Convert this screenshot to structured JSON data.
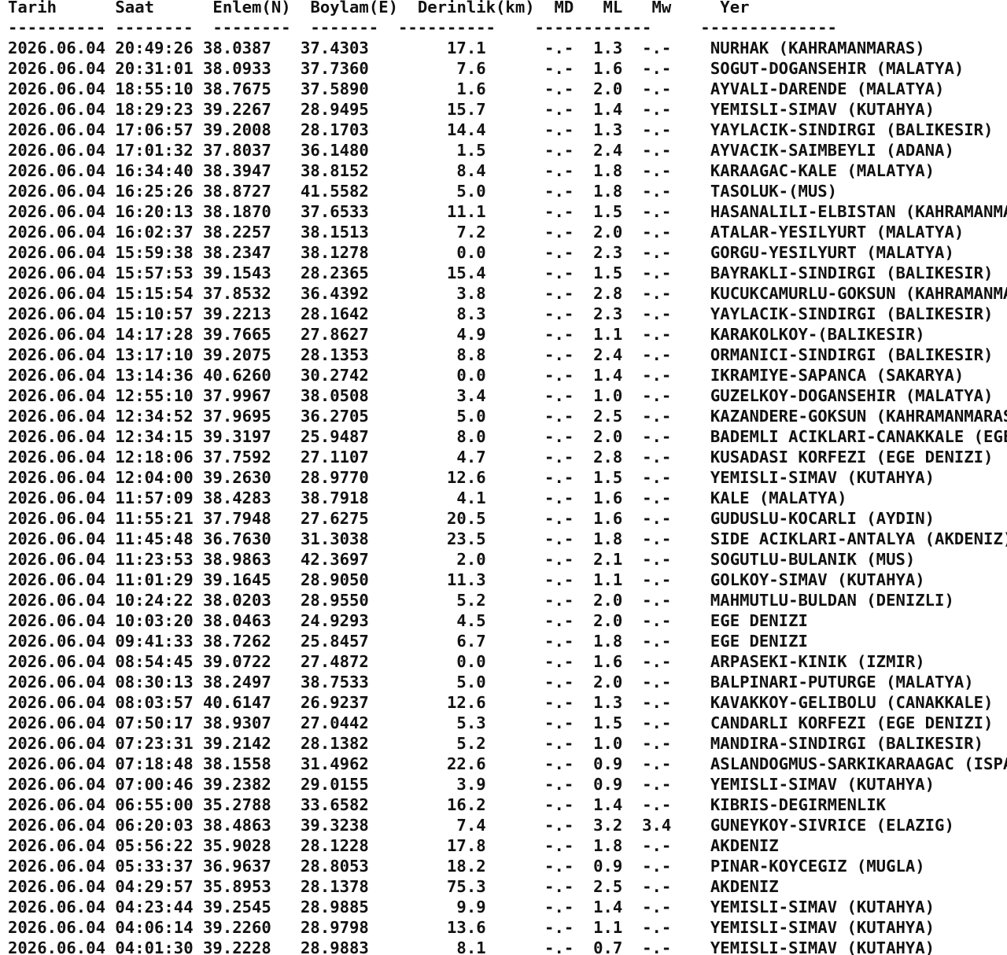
{
  "header": {
    "tarih": "Tarih",
    "saat": "Saat",
    "enlem": "Enlem(N)",
    "boylam": "Boylam(E)",
    "derinlik": "Derinlik(km)",
    "md": "MD",
    "ml": "ML",
    "mw": "Mw",
    "yer": "Yer"
  },
  "separator_line": "---------- --------  --------  -------  ----------    ------------     --------------",
  "rows": [
    [
      "2026.06.04",
      "20:49:26",
      "38.0387",
      "37.4303",
      "17.1",
      "-.-",
      "1.3",
      "-.-",
      "NURHAK (KAHRAMANMARAS)"
    ],
    [
      "2026.06.04",
      "20:31:01",
      "38.0933",
      "37.7360",
      "7.6",
      "-.-",
      "1.6",
      "-.-",
      "SOGUT-DOGANSEHIR (MALATYA)"
    ],
    [
      "2026.06.04",
      "18:55:10",
      "38.7675",
      "37.5890",
      "1.6",
      "-.-",
      "2.0",
      "-.-",
      "AYVALI-DARENDE (MALATYA)"
    ],
    [
      "2026.06.04",
      "18:29:23",
      "39.2267",
      "28.9495",
      "15.7",
      "-.-",
      "1.4",
      "-.-",
      "YEMISLI-SIMAV (KUTAHYA)"
    ],
    [
      "2026.06.04",
      "17:06:57",
      "39.2008",
      "28.1703",
      "14.4",
      "-.-",
      "1.3",
      "-.-",
      "YAYLACIK-SINDIRGI (BALIKESIR)"
    ],
    [
      "2026.06.04",
      "17:01:32",
      "37.8037",
      "36.1480",
      "1.5",
      "-.-",
      "2.4",
      "-.-",
      "AYVACIK-SAIMBEYLI (ADANA)"
    ],
    [
      "2026.06.04",
      "16:34:40",
      "38.3947",
      "38.8152",
      "8.4",
      "-.-",
      "1.8",
      "-.-",
      "KARAAGAC-KALE (MALATYA)"
    ],
    [
      "2026.06.04",
      "16:25:26",
      "38.8727",
      "41.5582",
      "5.0",
      "-.-",
      "1.8",
      "-.-",
      "TASOLUK-(MUS)"
    ],
    [
      "2026.06.04",
      "16:20:13",
      "38.1870",
      "37.6533",
      "11.1",
      "-.-",
      "1.5",
      "-.-",
      "HASANALILI-ELBISTAN (KAHRAMANMARAS)"
    ],
    [
      "2026.06.04",
      "16:02:37",
      "38.2257",
      "38.1513",
      "7.2",
      "-.-",
      "2.0",
      "-.-",
      "ATALAR-YESILYURT (MALATYA)"
    ],
    [
      "2026.06.04",
      "15:59:38",
      "38.2347",
      "38.1278",
      "0.0",
      "-.-",
      "2.3",
      "-.-",
      "GORGU-YESILYURT (MALATYA)"
    ],
    [
      "2026.06.04",
      "15:57:53",
      "39.1543",
      "28.2365",
      "15.4",
      "-.-",
      "1.5",
      "-.-",
      "BAYRAKLI-SINDIRGI (BALIKESIR)"
    ],
    [
      "2026.06.04",
      "15:15:54",
      "37.8532",
      "36.4392",
      "3.8",
      "-.-",
      "2.8",
      "-.-",
      "KUCUKCAMURLU-GOKSUN (KAHRAMANMARAS)"
    ],
    [
      "2026.06.04",
      "15:10:57",
      "39.2213",
      "28.1642",
      "8.3",
      "-.-",
      "2.3",
      "-.-",
      "YAYLACIK-SINDIRGI (BALIKESIR)"
    ],
    [
      "2026.06.04",
      "14:17:28",
      "39.7665",
      "27.8627",
      "4.9",
      "-.-",
      "1.1",
      "-.-",
      "KARAKOLKOY-(BALIKESIR)"
    ],
    [
      "2026.06.04",
      "13:17:10",
      "39.2075",
      "28.1353",
      "8.8",
      "-.-",
      "2.4",
      "-.-",
      "ORMANICI-SINDIRGI (BALIKESIR)"
    ],
    [
      "2026.06.04",
      "13:14:36",
      "40.6260",
      "30.2742",
      "0.0",
      "-.-",
      "1.4",
      "-.-",
      "IKRAMIYE-SAPANCA (SAKARYA)"
    ],
    [
      "2026.06.04",
      "12:55:10",
      "37.9967",
      "38.0508",
      "3.4",
      "-.-",
      "1.0",
      "-.-",
      "GUZELKOY-DOGANSEHIR (MALATYA)"
    ],
    [
      "2026.06.04",
      "12:34:52",
      "37.9695",
      "36.2705",
      "5.0",
      "-.-",
      "2.5",
      "-.-",
      "KAZANDERE-GOKSUN (KAHRAMANMARAS)"
    ],
    [
      "2026.06.04",
      "12:34:15",
      "39.3197",
      "25.9487",
      "8.0",
      "-.-",
      "2.0",
      "-.-",
      "BADEMLI ACIKLARI-CANAKKALE (EGE DENIZI)"
    ],
    [
      "2026.06.04",
      "12:18:06",
      "37.7592",
      "27.1107",
      "4.7",
      "-.-",
      "2.8",
      "-.-",
      "KUSADASI KORFEZI (EGE DENIZI)"
    ],
    [
      "2026.06.04",
      "12:04:00",
      "39.2630",
      "28.9770",
      "12.6",
      "-.-",
      "1.5",
      "-.-",
      "YEMISLI-SIMAV (KUTAHYA)"
    ],
    [
      "2026.06.04",
      "11:57:09",
      "38.4283",
      "38.7918",
      "4.1",
      "-.-",
      "1.6",
      "-.-",
      "KALE (MALATYA)"
    ],
    [
      "2026.06.04",
      "11:55:21",
      "37.7948",
      "27.6275",
      "20.5",
      "-.-",
      "1.6",
      "-.-",
      "GUDUSLU-KOCARLI (AYDIN)"
    ],
    [
      "2026.06.04",
      "11:45:48",
      "36.7630",
      "31.3038",
      "23.5",
      "-.-",
      "1.8",
      "-.-",
      "SIDE ACIKLARI-ANTALYA (AKDENIZ)"
    ],
    [
      "2026.06.04",
      "11:23:53",
      "38.9863",
      "42.3697",
      "2.0",
      "-.-",
      "2.1",
      "-.-",
      "SOGUTLU-BULANIK (MUS)"
    ],
    [
      "2026.06.04",
      "11:01:29",
      "39.1645",
      "28.9050",
      "11.3",
      "-.-",
      "1.1",
      "-.-",
      "GOLKOY-SIMAV (KUTAHYA)"
    ],
    [
      "2026.06.04",
      "10:24:22",
      "38.0203",
      "28.9550",
      "5.2",
      "-.-",
      "2.0",
      "-.-",
      "MAHMUTLU-BULDAN (DENIZLI)"
    ],
    [
      "2026.06.04",
      "10:03:20",
      "38.0463",
      "24.9293",
      "4.5",
      "-.-",
      "2.0",
      "-.-",
      "EGE DENIZI"
    ],
    [
      "2026.06.04",
      "09:41:33",
      "38.7262",
      "25.8457",
      "6.7",
      "-.-",
      "1.8",
      "-.-",
      "EGE DENIZI"
    ],
    [
      "2026.06.04",
      "08:54:45",
      "39.0722",
      "27.4872",
      "0.0",
      "-.-",
      "1.6",
      "-.-",
      "ARPASEKI-KINIK (IZMIR)"
    ],
    [
      "2026.06.04",
      "08:30:13",
      "38.2497",
      "38.7533",
      "5.0",
      "-.-",
      "2.0",
      "-.-",
      "BALPINARI-PUTURGE (MALATYA)"
    ],
    [
      "2026.06.04",
      "08:03:57",
      "40.6147",
      "26.9237",
      "12.6",
      "-.-",
      "1.3",
      "-.-",
      "KAVAKKOY-GELIBOLU (CANAKKALE)"
    ],
    [
      "2026.06.04",
      "07:50:17",
      "38.9307",
      "27.0442",
      "5.3",
      "-.-",
      "1.5",
      "-.-",
      "CANDARLI KORFEZI (EGE DENIZI)"
    ],
    [
      "2026.06.04",
      "07:23:31",
      "39.2142",
      "28.1382",
      "5.2",
      "-.-",
      "1.0",
      "-.-",
      "MANDIRA-SINDIRGI (BALIKESIR)"
    ],
    [
      "2026.06.04",
      "07:18:48",
      "38.1558",
      "31.4962",
      "22.6",
      "-.-",
      "0.9",
      "-.-",
      "ASLANDOGMUS-SARKIKARAAGAC (ISPARTA)"
    ],
    [
      "2026.06.04",
      "07:00:46",
      "39.2382",
      "29.0155",
      "3.9",
      "-.-",
      "0.9",
      "-.-",
      "YEMISLI-SIMAV (KUTAHYA)"
    ],
    [
      "2026.06.04",
      "06:55:00",
      "35.2788",
      "33.6582",
      "16.2",
      "-.-",
      "1.4",
      "-.-",
      "KIBRIS-DEGIRMENLIK"
    ],
    [
      "2026.06.04",
      "06:20:03",
      "38.4863",
      "39.3238",
      "7.4",
      "-.-",
      "3.2",
      "3.4",
      "GUNEYKOY-SIVRICE (ELAZIG)"
    ],
    [
      "2026.06.04",
      "05:56:22",
      "35.9028",
      "28.1228",
      "17.8",
      "-.-",
      "1.8",
      "-.-",
      "AKDENIZ"
    ],
    [
      "2026.06.04",
      "05:33:37",
      "36.9637",
      "28.8053",
      "18.2",
      "-.-",
      "0.9",
      "-.-",
      "PINAR-KOYCEGIZ (MUGLA)"
    ],
    [
      "2026.06.04",
      "04:29:57",
      "35.8953",
      "28.1378",
      "75.3",
      "-.-",
      "2.5",
      "-.-",
      "AKDENIZ"
    ],
    [
      "2026.06.04",
      "04:23:44",
      "39.2545",
      "28.9885",
      "9.9",
      "-.-",
      "1.4",
      "-.-",
      "YEMISLI-SIMAV (KUTAHYA)"
    ],
    [
      "2026.06.04",
      "04:06:14",
      "39.2260",
      "28.9798",
      "13.6",
      "-.-",
      "1.1",
      "-.-",
      "YEMISLI-SIMAV (KUTAHYA)"
    ],
    [
      "2026.06.04",
      "04:01:30",
      "39.2228",
      "28.9883",
      "8.1",
      "-.-",
      "0.7",
      "-.-",
      "YEMISLI-SIMAV (KUTAHYA)"
    ]
  ]
}
